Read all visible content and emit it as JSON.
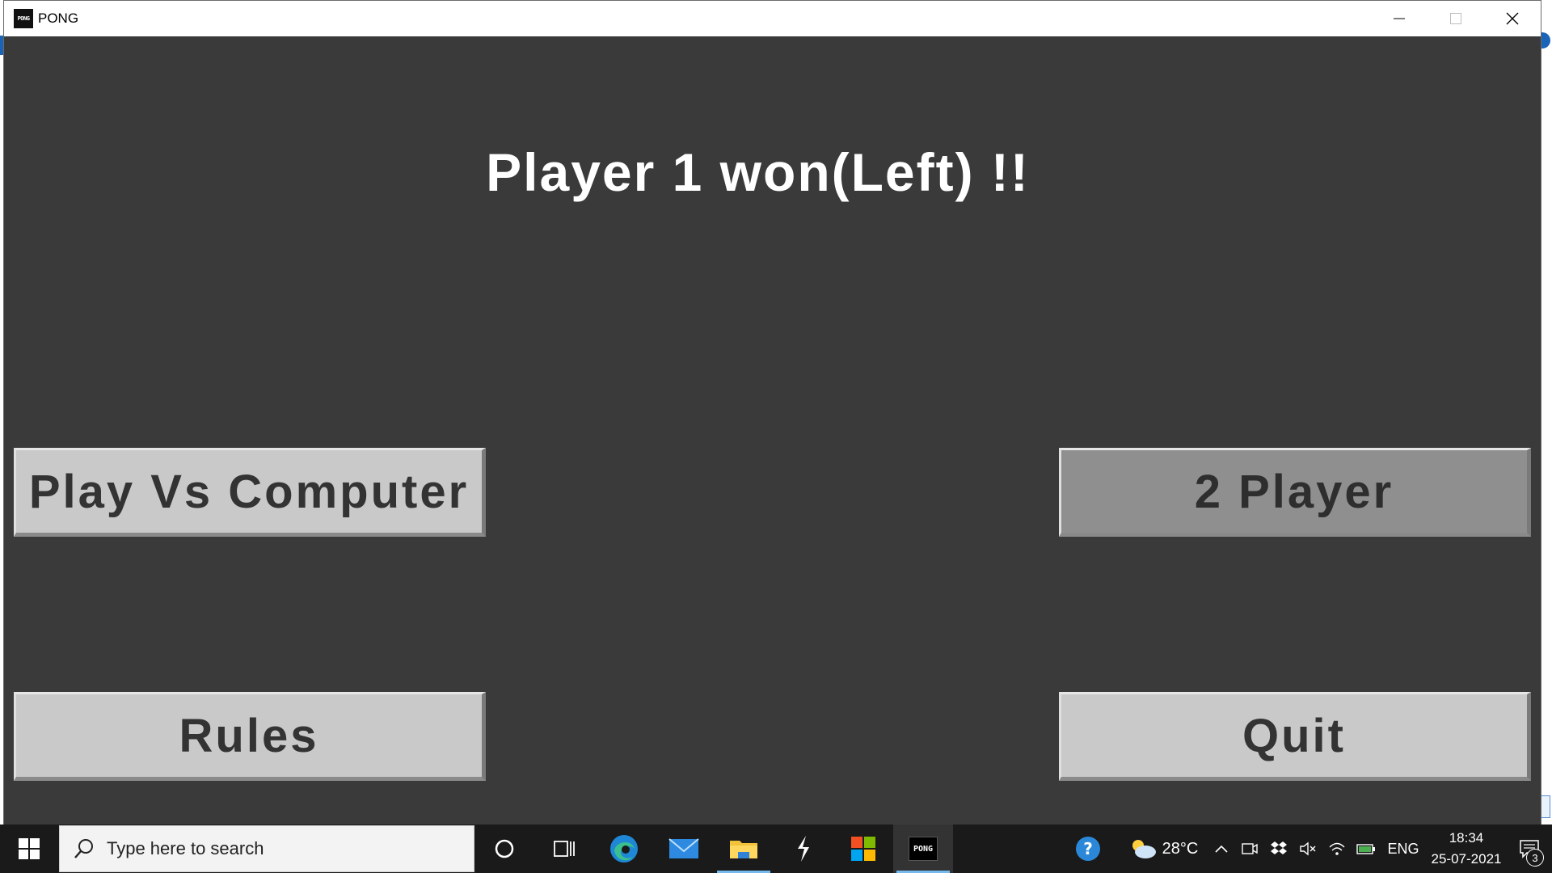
{
  "window": {
    "title": "PONG",
    "icon_label": "PONG",
    "icons": {
      "minimize": "minimize-icon",
      "maximize": "maximize-icon",
      "close": "close-icon"
    }
  },
  "game": {
    "winner_message": "Player 1 won(Left) !!",
    "buttons": {
      "play_vs_computer": "Play Vs Computer",
      "two_player": "2 Player",
      "rules": "Rules",
      "quit": "Quit"
    }
  },
  "taskbar": {
    "search_placeholder": "Type here to search",
    "pinned": [
      {
        "name": "cortana-icon"
      },
      {
        "name": "task-view-icon"
      },
      {
        "name": "edge-icon"
      },
      {
        "name": "mail-icon"
      },
      {
        "name": "file-explorer-icon",
        "active_underline": true
      },
      {
        "name": "app-icon"
      },
      {
        "name": "microsoft-store-icon"
      },
      {
        "name": "pong-taskbar-icon",
        "label": "PONG",
        "active": true
      }
    ],
    "tray": {
      "weather_temp": "28°C",
      "language": "ENG",
      "time": "18:34",
      "date": "25-07-2021",
      "notification_count": "3"
    }
  },
  "colors": {
    "game_background": "#3a3a3a",
    "button_light": "#c9c9c9",
    "button_dark": "#8f8f8f",
    "text_white": "#ffffff",
    "taskbar": "#1a1a1a",
    "accent": "#76b9ed"
  }
}
